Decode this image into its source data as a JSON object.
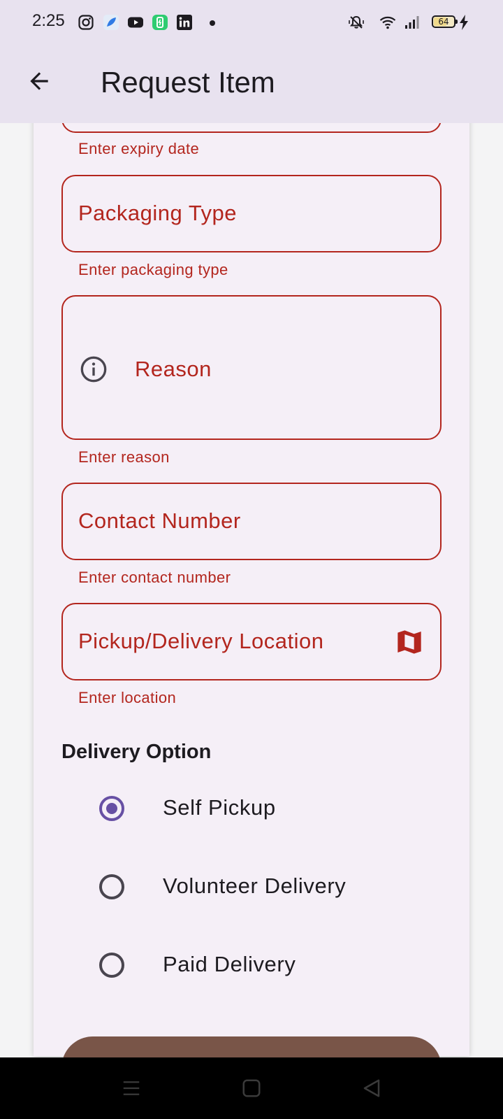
{
  "status_bar": {
    "time": "2:25",
    "battery_level": "64",
    "battery_fraction": 0.64,
    "icons": [
      "instagram-icon",
      "feather-app-icon",
      "youtube-icon",
      "battery-saver-app-icon",
      "linkedin-icon",
      "notification-dot",
      "silent-mode-icon",
      "wifi-icon",
      "signal-icon",
      "battery-icon",
      "charging-bolt-icon"
    ]
  },
  "app_bar": {
    "title": "Request Item",
    "back_icon": "arrow-back-icon"
  },
  "form": {
    "expiry_date": {
      "helper": "Enter expiry date"
    },
    "packaging_type": {
      "label": "Packaging Type",
      "helper": "Enter packaging type"
    },
    "reason": {
      "label": "Reason",
      "helper": "Enter reason",
      "icon": "info-icon"
    },
    "contact_number": {
      "label": "Contact Number",
      "helper": "Enter contact number"
    },
    "location": {
      "label": "Pickup/Delivery Location",
      "helper": "Enter location",
      "icon": "map-icon"
    }
  },
  "delivery": {
    "heading": "Delivery Option",
    "selected": "Self Pickup",
    "options": [
      {
        "label": "Self Pickup",
        "selected": true
      },
      {
        "label": "Volunteer Delivery",
        "selected": false
      },
      {
        "label": "Paid Delivery",
        "selected": false
      }
    ]
  },
  "colors": {
    "error": "#b3261e",
    "primary": "#6750a4",
    "submit_button": "#795548",
    "app_bar": "#e8e2ef",
    "card": "#f5eff7"
  },
  "nav_bar": {
    "buttons": [
      "menu-icon",
      "home-icon",
      "back-triangle-icon"
    ]
  }
}
